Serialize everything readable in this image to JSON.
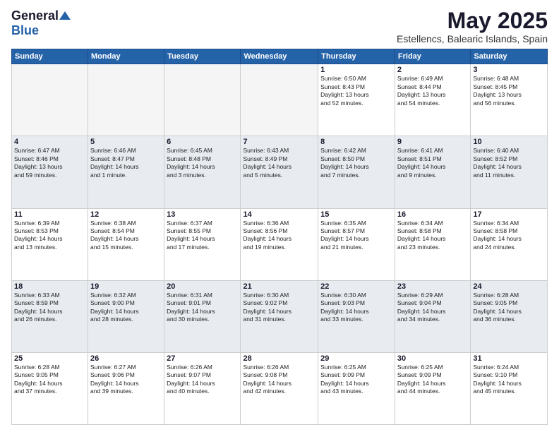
{
  "logo": {
    "general": "General",
    "blue": "Blue"
  },
  "title": "May 2025",
  "location": "Estellencs, Balearic Islands, Spain",
  "days_header": [
    "Sunday",
    "Monday",
    "Tuesday",
    "Wednesday",
    "Thursday",
    "Friday",
    "Saturday"
  ],
  "weeks": [
    [
      {
        "day": "",
        "info": ""
      },
      {
        "day": "",
        "info": ""
      },
      {
        "day": "",
        "info": ""
      },
      {
        "day": "",
        "info": ""
      },
      {
        "day": "1",
        "info": "Sunrise: 6:50 AM\nSunset: 8:43 PM\nDaylight: 13 hours\nand 52 minutes."
      },
      {
        "day": "2",
        "info": "Sunrise: 6:49 AM\nSunset: 8:44 PM\nDaylight: 13 hours\nand 54 minutes."
      },
      {
        "day": "3",
        "info": "Sunrise: 6:48 AM\nSunset: 8:45 PM\nDaylight: 13 hours\nand 56 minutes."
      }
    ],
    [
      {
        "day": "4",
        "info": "Sunrise: 6:47 AM\nSunset: 8:46 PM\nDaylight: 13 hours\nand 59 minutes."
      },
      {
        "day": "5",
        "info": "Sunrise: 6:46 AM\nSunset: 8:47 PM\nDaylight: 14 hours\nand 1 minute."
      },
      {
        "day": "6",
        "info": "Sunrise: 6:45 AM\nSunset: 8:48 PM\nDaylight: 14 hours\nand 3 minutes."
      },
      {
        "day": "7",
        "info": "Sunrise: 6:43 AM\nSunset: 8:49 PM\nDaylight: 14 hours\nand 5 minutes."
      },
      {
        "day": "8",
        "info": "Sunrise: 6:42 AM\nSunset: 8:50 PM\nDaylight: 14 hours\nand 7 minutes."
      },
      {
        "day": "9",
        "info": "Sunrise: 6:41 AM\nSunset: 8:51 PM\nDaylight: 14 hours\nand 9 minutes."
      },
      {
        "day": "10",
        "info": "Sunrise: 6:40 AM\nSunset: 8:52 PM\nDaylight: 14 hours\nand 11 minutes."
      }
    ],
    [
      {
        "day": "11",
        "info": "Sunrise: 6:39 AM\nSunset: 8:53 PM\nDaylight: 14 hours\nand 13 minutes."
      },
      {
        "day": "12",
        "info": "Sunrise: 6:38 AM\nSunset: 8:54 PM\nDaylight: 14 hours\nand 15 minutes."
      },
      {
        "day": "13",
        "info": "Sunrise: 6:37 AM\nSunset: 8:55 PM\nDaylight: 14 hours\nand 17 minutes."
      },
      {
        "day": "14",
        "info": "Sunrise: 6:36 AM\nSunset: 8:56 PM\nDaylight: 14 hours\nand 19 minutes."
      },
      {
        "day": "15",
        "info": "Sunrise: 6:35 AM\nSunset: 8:57 PM\nDaylight: 14 hours\nand 21 minutes."
      },
      {
        "day": "16",
        "info": "Sunrise: 6:34 AM\nSunset: 8:58 PM\nDaylight: 14 hours\nand 23 minutes."
      },
      {
        "day": "17",
        "info": "Sunrise: 6:34 AM\nSunset: 8:58 PM\nDaylight: 14 hours\nand 24 minutes."
      }
    ],
    [
      {
        "day": "18",
        "info": "Sunrise: 6:33 AM\nSunset: 8:59 PM\nDaylight: 14 hours\nand 26 minutes."
      },
      {
        "day": "19",
        "info": "Sunrise: 6:32 AM\nSunset: 9:00 PM\nDaylight: 14 hours\nand 28 minutes."
      },
      {
        "day": "20",
        "info": "Sunrise: 6:31 AM\nSunset: 9:01 PM\nDaylight: 14 hours\nand 30 minutes."
      },
      {
        "day": "21",
        "info": "Sunrise: 6:30 AM\nSunset: 9:02 PM\nDaylight: 14 hours\nand 31 minutes."
      },
      {
        "day": "22",
        "info": "Sunrise: 6:30 AM\nSunset: 9:03 PM\nDaylight: 14 hours\nand 33 minutes."
      },
      {
        "day": "23",
        "info": "Sunrise: 6:29 AM\nSunset: 9:04 PM\nDaylight: 14 hours\nand 34 minutes."
      },
      {
        "day": "24",
        "info": "Sunrise: 6:28 AM\nSunset: 9:05 PM\nDaylight: 14 hours\nand 36 minutes."
      }
    ],
    [
      {
        "day": "25",
        "info": "Sunrise: 6:28 AM\nSunset: 9:05 PM\nDaylight: 14 hours\nand 37 minutes."
      },
      {
        "day": "26",
        "info": "Sunrise: 6:27 AM\nSunset: 9:06 PM\nDaylight: 14 hours\nand 39 minutes."
      },
      {
        "day": "27",
        "info": "Sunrise: 6:26 AM\nSunset: 9:07 PM\nDaylight: 14 hours\nand 40 minutes."
      },
      {
        "day": "28",
        "info": "Sunrise: 6:26 AM\nSunset: 9:08 PM\nDaylight: 14 hours\nand 42 minutes."
      },
      {
        "day": "29",
        "info": "Sunrise: 6:25 AM\nSunset: 9:09 PM\nDaylight: 14 hours\nand 43 minutes."
      },
      {
        "day": "30",
        "info": "Sunrise: 6:25 AM\nSunset: 9:09 PM\nDaylight: 14 hours\nand 44 minutes."
      },
      {
        "day": "31",
        "info": "Sunrise: 6:24 AM\nSunset: 9:10 PM\nDaylight: 14 hours\nand 45 minutes."
      }
    ]
  ]
}
